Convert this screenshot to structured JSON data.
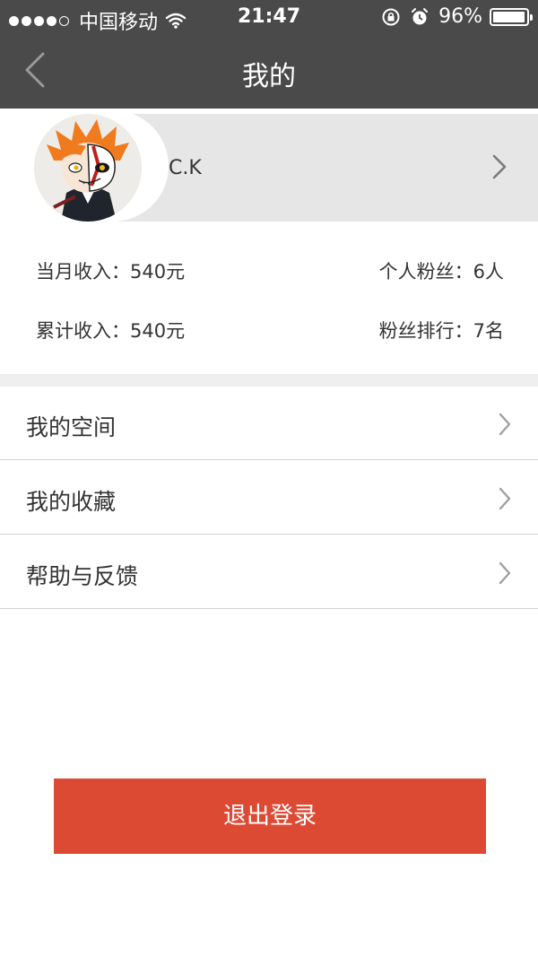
{
  "status_bar": {
    "carrier": "中国移动",
    "time": "21:47",
    "battery": "96%",
    "battery_level": 0.96,
    "icons": [
      "signal-dots-icon",
      "wifi-icon",
      "rotation-lock-icon",
      "alarm-icon",
      "battery-icon"
    ]
  },
  "nav": {
    "title": "我的",
    "back_icon": "chevron-left-icon"
  },
  "profile": {
    "name": "C.K",
    "chevron_icon": "chevron-right-icon"
  },
  "stats": {
    "monthly_income": "当月收入：540元",
    "total_income": "累计收入：540元",
    "fans": "个人粉丝：6人",
    "fans_rank": "粉丝排行：7名"
  },
  "menu": {
    "items": [
      {
        "label": "我的空间"
      },
      {
        "label": "我的收藏"
      },
      {
        "label": "帮助与反馈"
      }
    ]
  },
  "logout": {
    "label": "退出登录"
  },
  "colors": {
    "header_bg": "#4a4a4a",
    "logout_bg": "#dd4a34",
    "profile_bg": "#e6e6e6"
  }
}
